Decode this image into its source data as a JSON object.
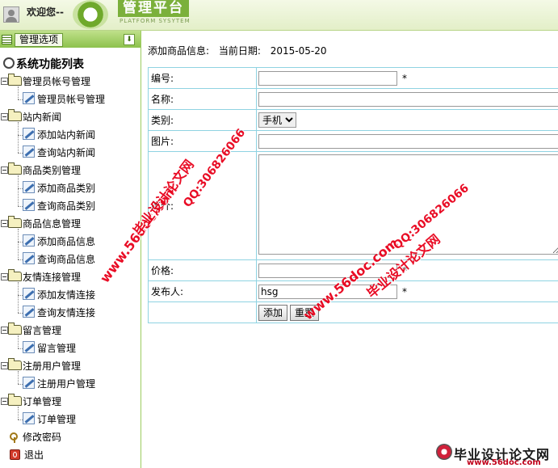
{
  "header": {
    "welcome": "欢迎您--",
    "logo_title": "管理平台",
    "logo_subtitle": "PLATFORM SYSYTEM"
  },
  "sidebar": {
    "menu_button": "管理选项",
    "root": "系统功能列表",
    "groups": [
      {
        "label": "管理员帐号管理",
        "items": [
          "管理员帐号管理"
        ]
      },
      {
        "label": "站内新闻",
        "items": [
          "添加站内新闻",
          "查询站内新闻"
        ]
      },
      {
        "label": "商品类别管理",
        "items": [
          "添加商品类别",
          "查询商品类别"
        ]
      },
      {
        "label": "商品信息管理",
        "items": [
          "添加商品信息",
          "查询商品信息"
        ]
      },
      {
        "label": "友情连接管理",
        "items": [
          "添加友情连接",
          "查询友情连接"
        ]
      },
      {
        "label": "留言管理",
        "items": [
          "留言管理"
        ]
      },
      {
        "label": "注册用户管理",
        "items": [
          "注册用户管理"
        ]
      },
      {
        "label": "订单管理",
        "items": [
          "订单管理"
        ]
      }
    ],
    "extra": [
      "修改密码",
      "退出"
    ]
  },
  "main": {
    "title": "添加商品信息:",
    "date_label": "当前日期:",
    "date": "2015-05-20",
    "form": {
      "id_label": "编号:",
      "id_value": "",
      "name_label": "名称:",
      "name_value": "",
      "category_label": "类别:",
      "category_value": "手机",
      "image_label": "图片:",
      "image_value": "",
      "intro_label": "简介:",
      "intro_value": "",
      "price_label": "价格:",
      "price_value": "",
      "publisher_label": "发布人:",
      "publisher_value": "hsg",
      "required_mark": "*",
      "submit_label": "添加",
      "reset_label": "重置"
    }
  },
  "watermarks": {
    "site_cn": "毕业设计论文网",
    "url": "www.56doc.com",
    "qq": "QQ:306826066",
    "footer_title": "毕业设计论文网",
    "footer_url": "www.56doc.com"
  },
  "colors": {
    "accent_green": "#8dc24d",
    "table_border": "#8fd3e2",
    "watermark_red": "#e8001a"
  }
}
